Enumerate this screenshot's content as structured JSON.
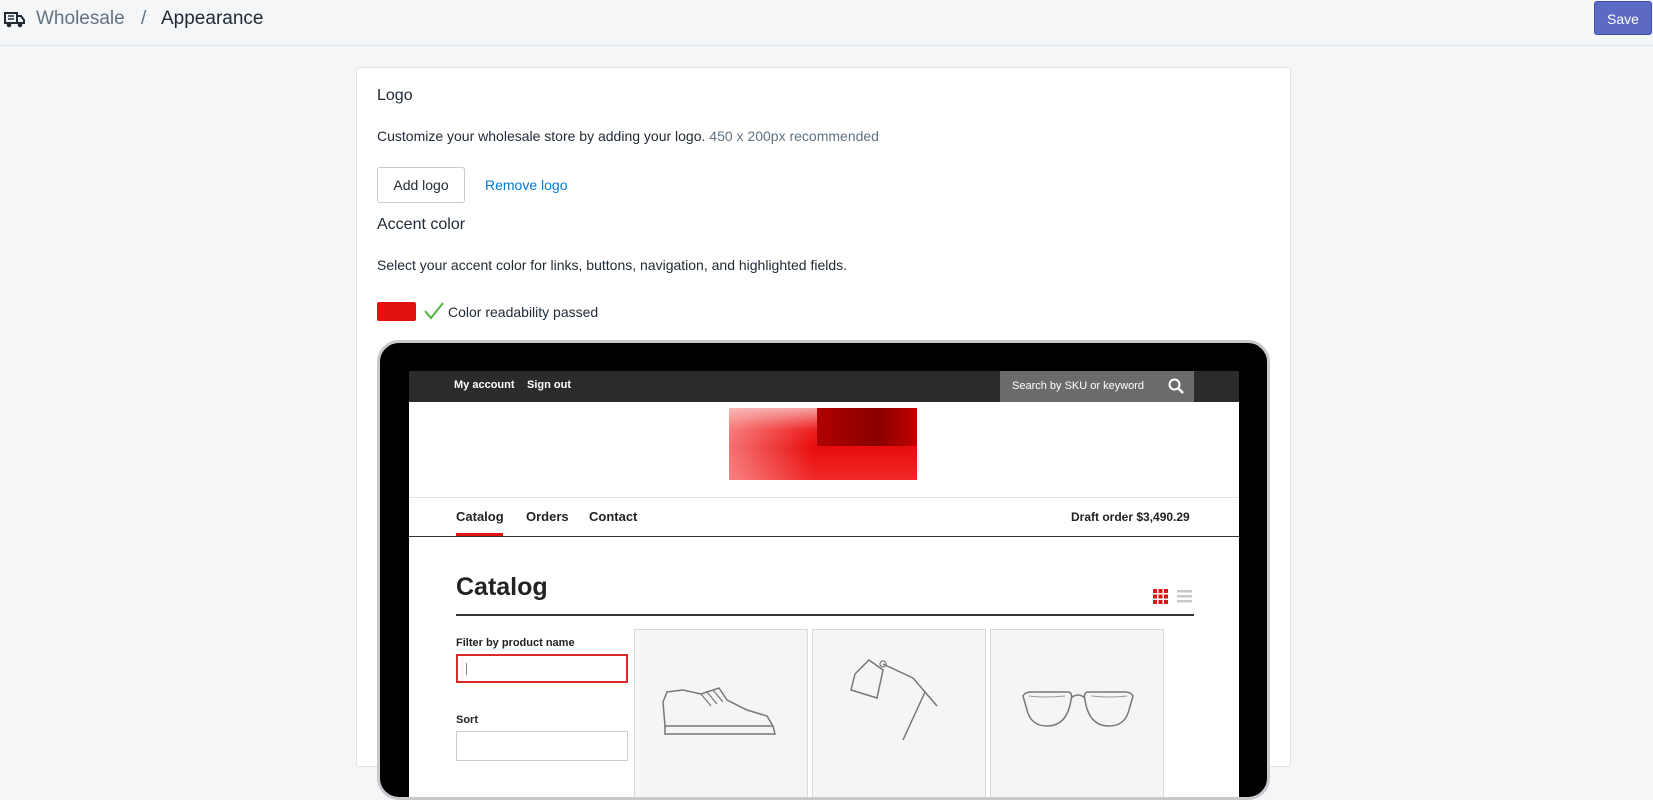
{
  "header": {
    "breadcrumb_root": "Wholesale",
    "separator": "/",
    "current": "Appearance",
    "save_label": "Save",
    "app_icon": "truck-icon"
  },
  "logo_section": {
    "title": "Logo",
    "description": "Customize your wholesale store by adding your logo.",
    "hint": "450 x 200px recommended",
    "add_button": "Add logo",
    "remove_link": "Remove logo"
  },
  "accent_section": {
    "title": "Accent color",
    "description": "Select your accent color for links, buttons, navigation, and highlighted fields.",
    "accent_color": "#e31212",
    "readability_text": "Color readability passed",
    "readability_icon": "checkmark-icon"
  },
  "preview": {
    "top_links": [
      "My account",
      "Sign out"
    ],
    "search_placeholder": "Search by SKU or keyword",
    "nav_items": [
      "Catalog",
      "Orders",
      "Contact"
    ],
    "active_nav": "Catalog",
    "draft_order": "Draft order $3,490.29",
    "page_title": "Catalog",
    "filter_label": "Filter by product name",
    "sort_label": "Sort",
    "products": [
      "sneaker-icon",
      "desk-lamp-icon",
      "glasses-icon"
    ]
  }
}
